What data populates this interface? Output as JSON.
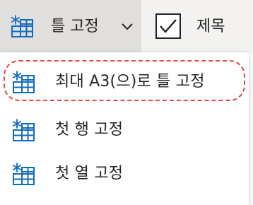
{
  "ribbon": {
    "freeze_button": {
      "label": "틀 고정",
      "icon": "freeze-panes-icon",
      "chevron": "chevron-down-icon"
    },
    "title_checkbox": {
      "label": "제목",
      "checked": true,
      "icon": "checkmark-icon"
    }
  },
  "menu": {
    "items": [
      {
        "label": "최대 A3(으)로 틀 고정",
        "icon": "freeze-panes-icon",
        "highlighted": true
      },
      {
        "label": "첫 행 고정",
        "icon": "freeze-panes-icon",
        "highlighted": false
      },
      {
        "label": "첫 열 고정",
        "icon": "freeze-panes-icon",
        "highlighted": false
      }
    ]
  },
  "colors": {
    "ribbon_bg": "#f3f2f1",
    "button_pressed_bg": "#e1dfdd",
    "icon_blue": "#0f6cbd",
    "highlight_ring": "#e4473c",
    "text": "#252423"
  }
}
